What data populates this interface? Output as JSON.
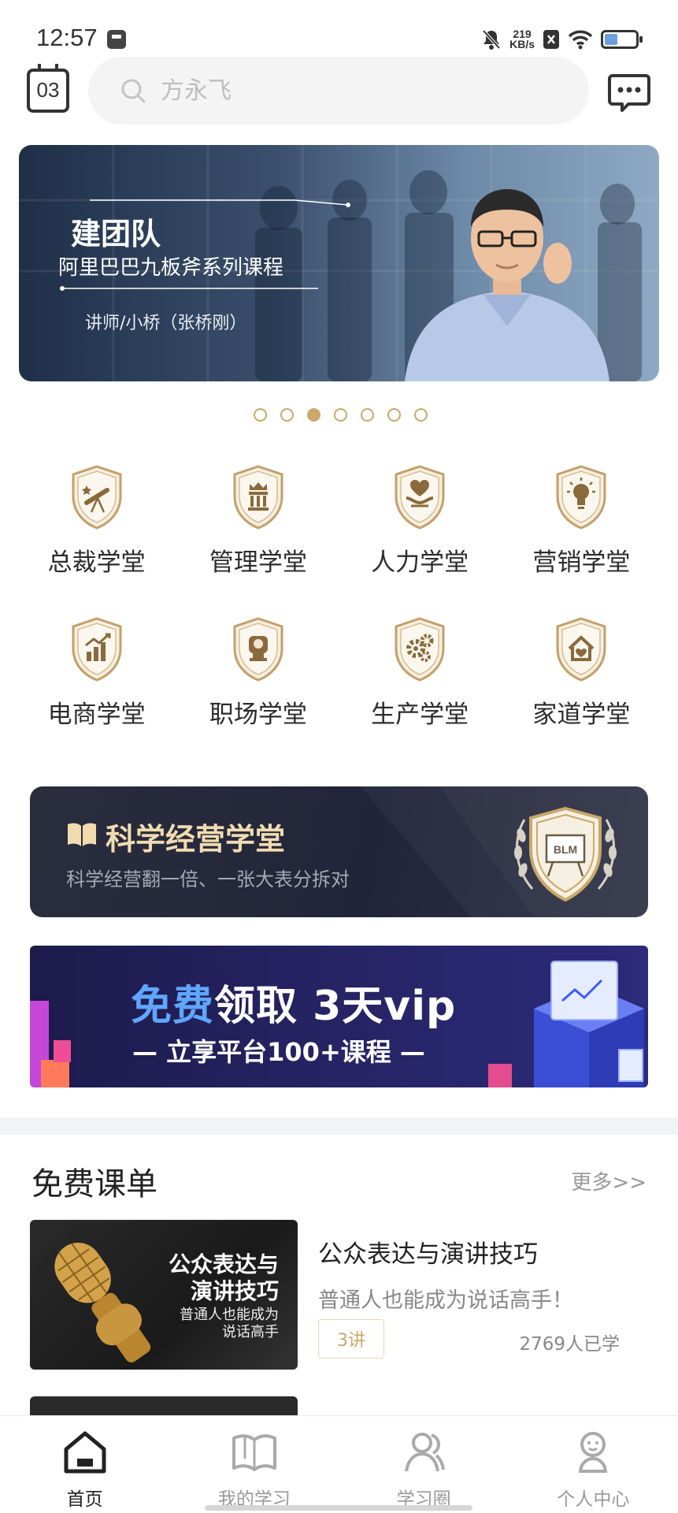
{
  "status": {
    "time": "12:57",
    "speed_value": "219",
    "speed_unit": "KB/s"
  },
  "header": {
    "calendar_day": "03",
    "search_placeholder": "方永飞"
  },
  "banner": {
    "title": "建团队",
    "subtitle": "阿里巴巴九板斧系列课程",
    "teacher": "讲师/小桥（张桥刚）",
    "dot_count": 7,
    "active_dot": 2
  },
  "categories": [
    {
      "label": "总裁学堂",
      "icon": "telescope-shield-icon"
    },
    {
      "label": "管理学堂",
      "icon": "crown-pillars-shield-icon"
    },
    {
      "label": "人力学堂",
      "icon": "heart-hands-shield-icon"
    },
    {
      "label": "营销学堂",
      "icon": "lightbulb-shield-icon"
    },
    {
      "label": "电商学堂",
      "icon": "chart-shield-icon"
    },
    {
      "label": "职场学堂",
      "icon": "briefcase-shield-icon"
    },
    {
      "label": "生产学堂",
      "icon": "gears-shield-icon"
    },
    {
      "label": "家道学堂",
      "icon": "home-heart-shield-icon"
    }
  ],
  "promo_card": {
    "title": "科学经营学堂",
    "subtitle": "科学经营翻一倍、一张大表分拆对",
    "badge_text": "BLM"
  },
  "vip_banner": {
    "title_free": "免费",
    "title_rest": "领取 3天vip",
    "subtitle": "— 立享平台100+课程 —"
  },
  "free_list": {
    "title": "免费课单",
    "more": "更多>>",
    "courses": [
      {
        "name": "公众表达与演讲技巧",
        "desc": "普通人也能成为说话高手！",
        "lectures": "3讲",
        "learners": "2769人已学",
        "thumb_title_1": "公众表达与",
        "thumb_title_2": "演讲技巧",
        "thumb_sub_1": "普通人也能成为",
        "thumb_sub_2": "说话高手"
      }
    ]
  },
  "tabs": [
    {
      "label": "首页",
      "icon": "home-icon",
      "active": true
    },
    {
      "label": "我的学习",
      "icon": "book-icon",
      "active": false
    },
    {
      "label": "学习圈",
      "icon": "people-icon",
      "active": false
    },
    {
      "label": "个人中心",
      "icon": "person-icon",
      "active": false
    }
  ],
  "colors": {
    "gold": "#c9a86a",
    "dark_card": "#23263a",
    "vip_bg": "#262464",
    "vip_blue": "#5fa6ff"
  }
}
